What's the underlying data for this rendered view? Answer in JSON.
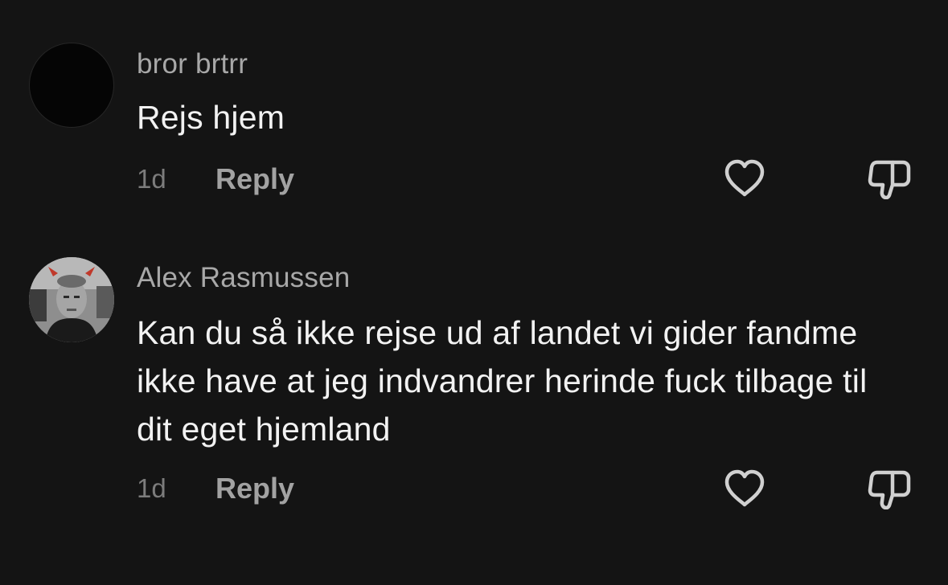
{
  "comments": [
    {
      "username": "bror brtrr",
      "text": "Rejs hjem",
      "time": "1d",
      "reply_label": "Reply"
    },
    {
      "username": "Alex Rasmussen",
      "text": "Kan du så ikke rejse ud af landet vi gider fandme ikke have at jeg indvandrer herinde fuck tilbage til dit eget hjemland",
      "time": "1d",
      "reply_label": "Reply"
    }
  ],
  "icons": {
    "like": "heart-outline-icon",
    "dislike": "thumbs-down-outline-icon"
  },
  "colors": {
    "background": "#141414",
    "username": "#a8a8a8",
    "comment_text": "#f2f2f2",
    "timestamp": "#7c7c7c",
    "reply": "#a2a2a2",
    "icon": "#d0d0d0"
  }
}
